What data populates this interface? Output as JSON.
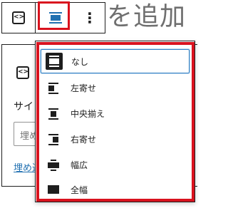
{
  "page": {
    "heading": "を追加"
  },
  "toolbar": {
    "embed_icon": "embed-icon",
    "embed_glyph": "<>",
    "align_icon": "align-none-icon",
    "more_glyph": "⋮"
  },
  "block_panel": {
    "label": "サイト",
    "input_placeholder": "埋め込",
    "link_text": "埋め込"
  },
  "align_menu": {
    "items": [
      {
        "label": "なし",
        "icon": "align-none-icon",
        "selected": true
      },
      {
        "label": "左寄せ",
        "icon": "align-left-icon",
        "selected": false
      },
      {
        "label": "中央揃え",
        "icon": "align-center-icon",
        "selected": false
      },
      {
        "label": "右寄せ",
        "icon": "align-right-icon",
        "selected": false
      },
      {
        "label": "幅広",
        "icon": "align-wide-icon",
        "selected": false
      },
      {
        "label": "全幅",
        "icon": "align-full-icon",
        "selected": false
      }
    ]
  },
  "colors": {
    "highlight": "#d9121e",
    "accent": "#2271b1",
    "focus": "#3582c4"
  }
}
